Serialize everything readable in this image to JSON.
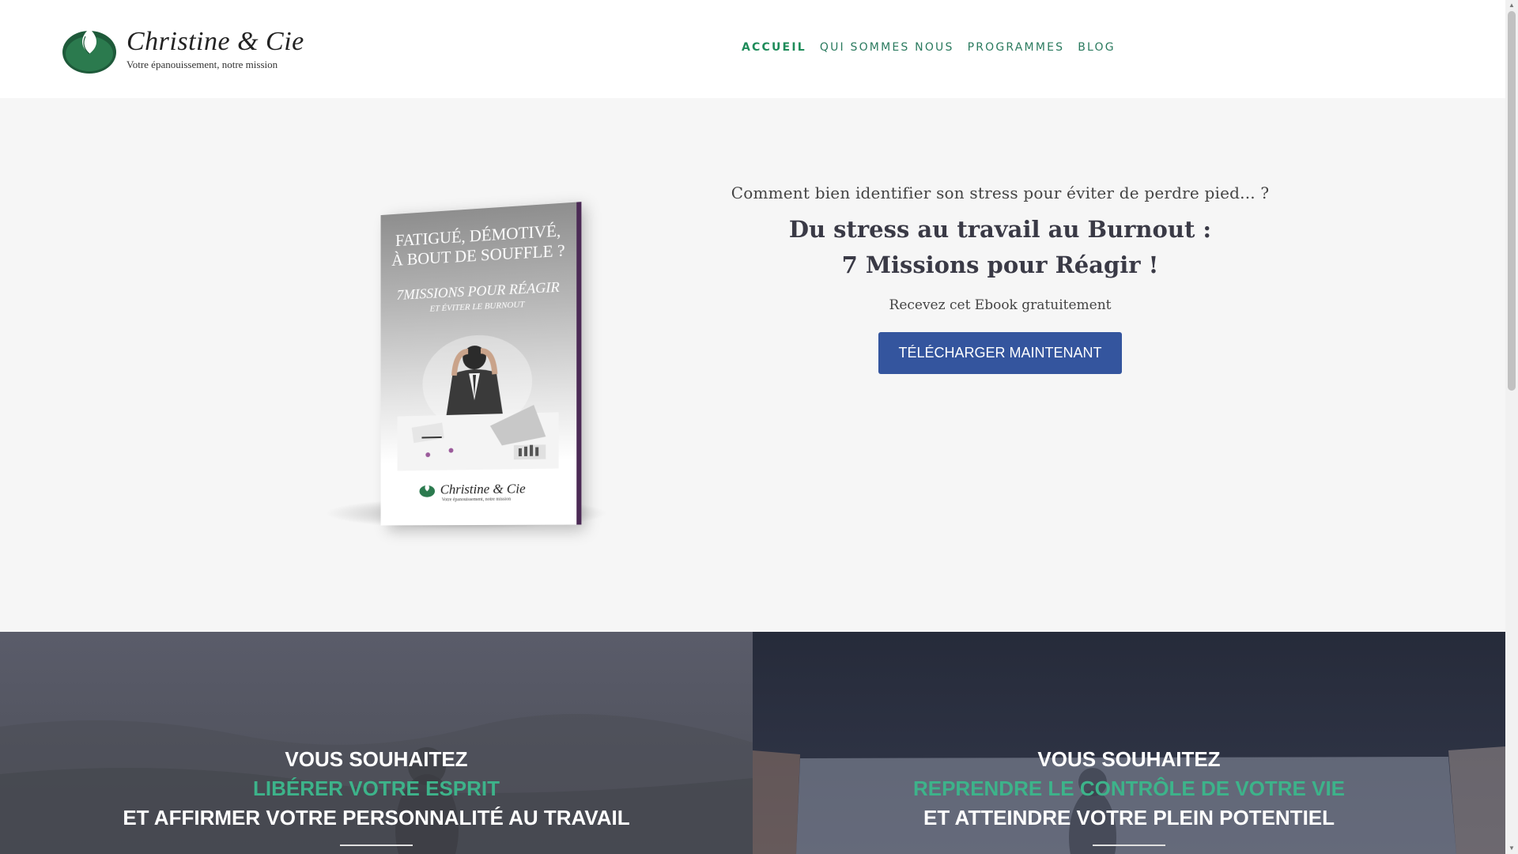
{
  "brand": {
    "name": "Christine & Cie",
    "tagline": "Votre épanouissement, notre mission"
  },
  "nav": {
    "items": [
      {
        "label": "ACCUEIL",
        "active": true
      },
      {
        "label": "QUI SOMMES NOUS",
        "active": false
      },
      {
        "label": "PROGRAMMES",
        "active": false
      },
      {
        "label": "BLOG",
        "active": false
      }
    ]
  },
  "hero": {
    "intro": "Comment bien identifier son stress pour éviter de perdre pied... ?",
    "title_line1": "Du stress au travail au Burnout :",
    "title_line2": "7 Missions pour Réagir !",
    "note": "Recevez cet Ebook gratuitement",
    "cta_label": "TÉLÉCHARGER MAINTENANT",
    "cta_color": "#34559e"
  },
  "book": {
    "title_line1": "FATIGUÉ, DÉMOTIVÉ,",
    "title_line2": "À BOUT DE SOUFFLE ?",
    "subtitle": "7MISSIONS POUR RÉAGIR",
    "subtitle2": "ET ÉVITER LE BURNOUT",
    "logo_name": "Christine & Cie",
    "logo_tag": "Votre épanouissement, notre mission"
  },
  "panels": {
    "left": {
      "line1": "VOUS SOUHAITEZ",
      "line2": "LIBÉRER VOTRE ESPRIT",
      "line3": "ET AFFIRMER VOTRE PERSONNALITÉ AU TRAVAIL"
    },
    "right": {
      "line1": "VOUS SOUHAITEZ",
      "line2": "REPRENDRE LE CONTRÔLE DE VOTRE VIE",
      "line3": "ET ATTEINDRE VOTRE PLEIN POTENTIEL"
    },
    "accent_color": "#3db38a"
  },
  "colors": {
    "brand_green": "#1f8c5a",
    "hero_bg": "#f6f6f6"
  }
}
